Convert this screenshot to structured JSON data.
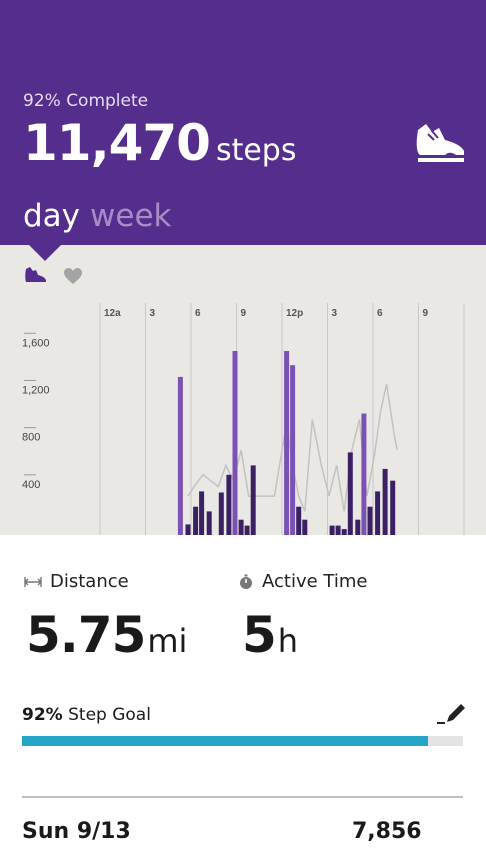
{
  "header": {
    "complete_text": "92% Complete",
    "steps_value": "11,470",
    "steps_unit": "steps",
    "tabs": [
      {
        "label": "day"
      },
      {
        "label": "week"
      }
    ],
    "active_tab": "day",
    "shoe_icon": "shoe-icon"
  },
  "colors": {
    "header_bg": "#552d8c",
    "bar_light": "#7a52b3",
    "bar_dark": "#3b2163",
    "progress": "#25a4c9",
    "chart_bg": "#e9e8e4"
  },
  "chart_icons": [
    "steps-shoe-icon",
    "heart-icon"
  ],
  "chart_data": {
    "type": "bar",
    "title": "",
    "x_tick_labels": [
      "12a",
      "3",
      "6",
      "9",
      "12p",
      "3",
      "6",
      "9"
    ],
    "y_tick_labels": [
      "1,600",
      "1,200",
      "800",
      "400"
    ],
    "y_ticks": [
      1600,
      1200,
      800,
      400
    ],
    "ylim": [
      0,
      1950
    ],
    "x_range_hours": [
      0,
      24
    ],
    "grid": true,
    "series": [
      {
        "bars": [
          {
            "hour": 5.3,
            "value": 1340,
            "tone": "light"
          },
          {
            "hour": 5.8,
            "value": 90,
            "tone": "dark"
          },
          {
            "hour": 6.3,
            "value": 240,
            "tone": "dark"
          },
          {
            "hour": 6.7,
            "value": 370,
            "tone": "dark"
          },
          {
            "hour": 7.2,
            "value": 200,
            "tone": "dark"
          },
          {
            "hour": 8.0,
            "value": 360,
            "tone": "dark"
          },
          {
            "hour": 8.5,
            "value": 510,
            "tone": "dark"
          },
          {
            "hour": 8.9,
            "value": 1560,
            "tone": "light"
          },
          {
            "hour": 9.3,
            "value": 130,
            "tone": "dark"
          },
          {
            "hour": 9.7,
            "value": 80,
            "tone": "dark"
          },
          {
            "hour": 10.1,
            "value": 590,
            "tone": "dark"
          },
          {
            "hour": 12.3,
            "value": 1560,
            "tone": "light"
          },
          {
            "hour": 12.7,
            "value": 1440,
            "tone": "light"
          },
          {
            "hour": 13.1,
            "value": 240,
            "tone": "dark"
          },
          {
            "hour": 13.5,
            "value": 130,
            "tone": "dark"
          },
          {
            "hour": 15.3,
            "value": 80,
            "tone": "dark"
          },
          {
            "hour": 15.7,
            "value": 80,
            "tone": "dark"
          },
          {
            "hour": 16.1,
            "value": 50,
            "tone": "dark"
          },
          {
            "hour": 16.5,
            "value": 700,
            "tone": "dark"
          },
          {
            "hour": 17.0,
            "value": 130,
            "tone": "dark"
          },
          {
            "hour": 17.4,
            "value": 1030,
            "tone": "light"
          },
          {
            "hour": 17.8,
            "value": 240,
            "tone": "dark"
          },
          {
            "hour": 18.3,
            "value": 370,
            "tone": "dark"
          },
          {
            "hour": 18.8,
            "value": 560,
            "tone": "dark"
          },
          {
            "hour": 19.3,
            "value": 460,
            "tone": "dark"
          }
        ]
      },
      {
        "line": [
          [
            5.8,
            330
          ],
          [
            6.3,
            430
          ],
          [
            6.8,
            510
          ],
          [
            7.3,
            460
          ],
          [
            7.8,
            410
          ],
          [
            8.3,
            590
          ],
          [
            8.8,
            460
          ],
          [
            9.3,
            720
          ],
          [
            9.8,
            330
          ],
          [
            10.3,
            330
          ],
          [
            11.1,
            330
          ],
          [
            11.5,
            330
          ],
          [
            11.9,
            640
          ],
          [
            12.3,
            940
          ],
          [
            12.7,
            590
          ],
          [
            13.1,
            330
          ],
          [
            13.5,
            200
          ],
          [
            14.0,
            980
          ],
          [
            14.6,
            590
          ],
          [
            15.1,
            330
          ],
          [
            15.6,
            590
          ],
          [
            16.1,
            200
          ],
          [
            16.6,
            720
          ],
          [
            17.1,
            980
          ],
          [
            17.6,
            330
          ],
          [
            18.1,
            680
          ],
          [
            18.5,
            1050
          ],
          [
            18.9,
            1280
          ],
          [
            19.4,
            850
          ],
          [
            19.6,
            720
          ]
        ]
      }
    ]
  },
  "stats": {
    "distance": {
      "label": "Distance",
      "value": "5.75",
      "unit": "mi"
    },
    "active_time": {
      "label": "Active Time",
      "value": "5",
      "unit": "h"
    }
  },
  "goal": {
    "percent_text": "92%",
    "label": "Step Goal",
    "progress": 0.92
  },
  "day_row": {
    "date": "Sun 9/13",
    "steps": "7,856"
  }
}
